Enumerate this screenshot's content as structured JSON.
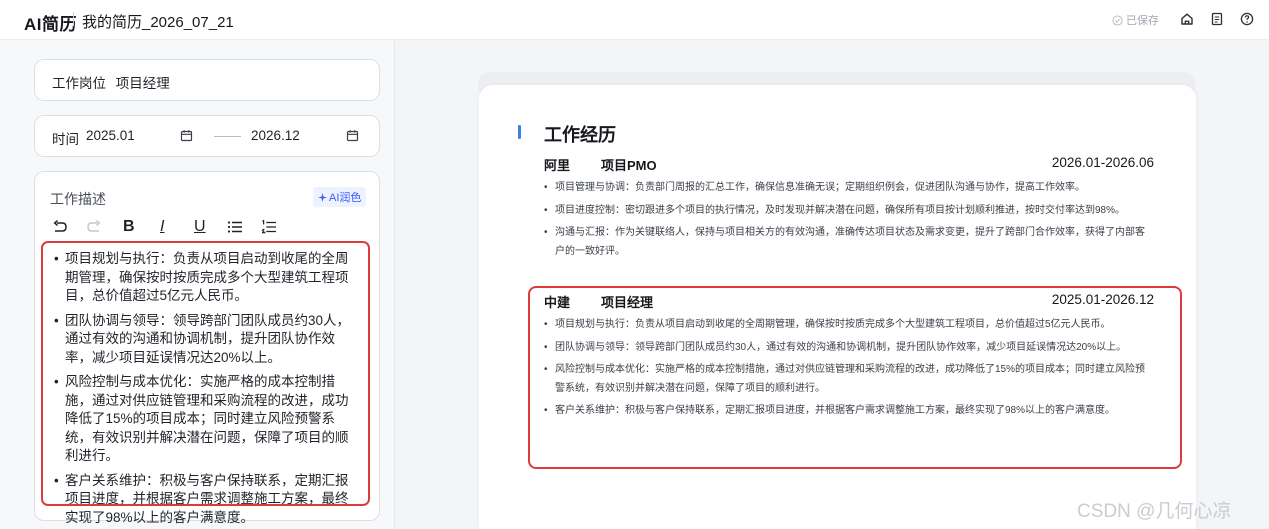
{
  "header": {
    "logo": "AI简历",
    "doc_title": "我的简历_2026_07_21",
    "saved_status": "已保存",
    "icons": [
      "home-icon",
      "document-icon",
      "help-icon"
    ]
  },
  "editor_form": {
    "position_label": "工作岗位",
    "position_value": "项目经理",
    "time_label": "时间",
    "start_date": "2025.01",
    "date_separator": "——",
    "end_date": "2026.12",
    "description_label": "工作描述",
    "ai_button": "AI润色",
    "toolbar": [
      "undo-icon",
      "redo-icon",
      "bold-icon",
      "italic-icon",
      "underline-icon",
      "bullet-list-icon",
      "numbered-list-icon"
    ],
    "bullets": [
      "项目规划与执行：负责从项目启动到收尾的全周期管理，确保按时按质完成多个大型建筑工程项目，总价值超过5亿元人民币。",
      "团队协调与领导：领导跨部门团队成员约30人，通过有效的沟通和协调机制，提升团队协作效率，减少项目延误情况达20%以上。",
      "风险控制与成本优化：实施严格的成本控制措施，通过对供应链管理和采购流程的改进，成功降低了15%的项目成本；同时建立风险预警系统，有效识别并解决潜在问题，保障了项目的顺利进行。",
      "客户关系维护：积极与客户保持联系，定期汇报项目进度，并根据客户需求调整施工方案，最终实现了98%以上的客户满意度。"
    ]
  },
  "preview": {
    "section_title": "工作经历",
    "jobs": [
      {
        "company": "阿里",
        "role": "项目PMO",
        "period": "2026.01-2026.06",
        "bullets": [
          "项目管理与协调：负责部门周报的汇总工作，确保信息准确无误；定期组织例会，促进团队沟通与协作，提高工作效率。",
          "项目进度控制：密切跟进多个项目的执行情况，及时发现并解决潜在问题，确保所有项目按计划顺利推进，按时交付率达到98%。",
          "沟通与汇报：作为关键联络人，保持与项目相关方的有效沟通，准确传达项目状态及需求变更，提升了跨部门合作效率，获得了内部客户的一致好评。"
        ]
      },
      {
        "company": "中建",
        "role": "项目经理",
        "period": "2025.01-2026.12",
        "bullets": [
          "项目规划与执行：负责从项目启动到收尾的全周期管理，确保按时按质完成多个大型建筑工程项目，总价值超过5亿元人民币。",
          "团队协调与领导：领导跨部门团队成员约30人，通过有效的沟通和协调机制，提升团队协作效率，减少项目延误情况达20%以上。",
          "风险控制与成本优化：实施严格的成本控制措施，通过对供应链管理和采购流程的改进，成功降低了15%的项目成本；同时建立风险预警系统，有效识别并解决潜在问题，保障了项目的顺利进行。",
          "客户关系维护：积极与客户保持联系，定期汇报项目进度，并根据客户需求调整施工方案，最终实现了98%以上的客户满意度。"
        ]
      }
    ]
  },
  "watermark": "CSDN @几何心凉",
  "colors": {
    "highlight": "#dc3b3b",
    "accent": "#3d7de4",
    "ai_button": "#3d5afe"
  }
}
